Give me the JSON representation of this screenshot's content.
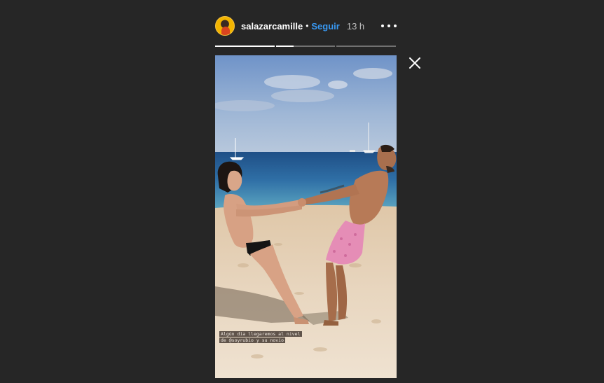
{
  "header": {
    "username": "salazarcamille",
    "separator": "•",
    "follow_label": "Seguir",
    "time": "13 h",
    "avatar_icon": "profile-avatar",
    "more_icon": "more-options-icon"
  },
  "progress": {
    "segments_total": 3,
    "segments_completed": 1,
    "current_segment_progress": 0.3
  },
  "close_icon": "close-icon",
  "story": {
    "caption": "Algún día llegaremos al nivel de @soyrubio y su novio"
  }
}
